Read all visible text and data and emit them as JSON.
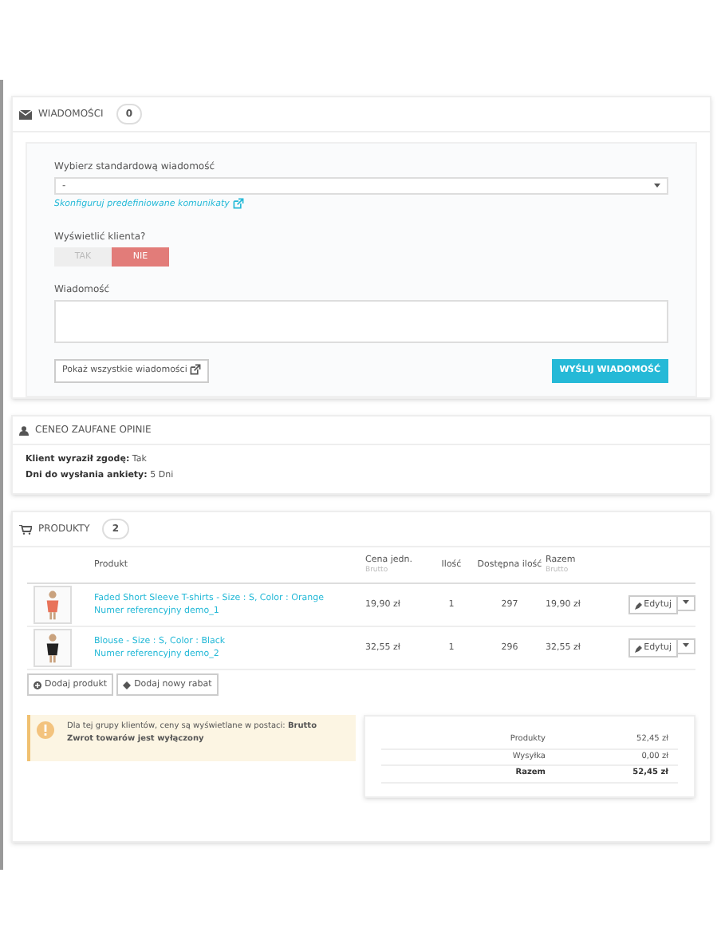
{
  "messages": {
    "title": "WIADOMOŚCI",
    "count": "0",
    "select_label": "Wybierz standardową wiadomość",
    "select_value": "-",
    "config_link": "Skonfiguruj predefiniowane komunikaty",
    "show_label": "Wyświetlić klienta?",
    "toggle": [
      {
        "label": "TAK",
        "selected": false
      },
      {
        "label": "NIE",
        "selected": true
      }
    ],
    "message_label": "Wiadomość",
    "show_all_button": "Pokaż wszystkie wiadomości",
    "send_button": "WYŚLIJ WIADOMOŚĆ"
  },
  "ceneo": {
    "title": "CENEO ZAUFANE OPINIE",
    "lines": [
      {
        "label": "Klient wyraził zgodę:",
        "value": "Tak"
      },
      {
        "label": "Dni do wysłania ankiety:",
        "value": "5 Dni"
      }
    ]
  },
  "products": {
    "title": "PRODUKTY",
    "count": "2",
    "columns": [
      {
        "label": "Produkt"
      },
      {
        "label": "Cena jedn.",
        "sub": "Brutto"
      },
      {
        "label": "Ilość"
      },
      {
        "label": "Dostępna ilość"
      },
      {
        "label": "Razem",
        "sub": "Brutto"
      }
    ],
    "rows": [
      {
        "name": "Faded Short Sleeve T-shirts - Size : S, Color : Orange",
        "ref": "Numer referencyjny demo_1",
        "price": "19,90 zł",
        "qty": "1",
        "available": "297",
        "total": "19,90 zł",
        "edit": "Edytuj"
      },
      {
        "name": "Blouse - Size : S, Color : Black",
        "ref": "Numer referencyjny demo_2",
        "price": "32,55 zł",
        "qty": "1",
        "available": "296",
        "total": "32,55 zł",
        "edit": "Edytuj"
      }
    ],
    "add_product": "Dodaj produkt",
    "add_discount": "Dodaj nowy rabat",
    "notice": {
      "text": "Dla tej grupy klientów, ceny są wyświetlane w postaci: **Brutto**",
      "bold_line": "Zwrot towarów jest wyłączony"
    },
    "totals": [
      {
        "label": "Produkty",
        "value": "52,45 zł",
        "bold": false
      },
      {
        "label": "Wysyłka",
        "value": "0,00 zł",
        "bold": false
      },
      {
        "label": "Razem",
        "value": "52,45 zł",
        "bold": true
      }
    ]
  }
}
